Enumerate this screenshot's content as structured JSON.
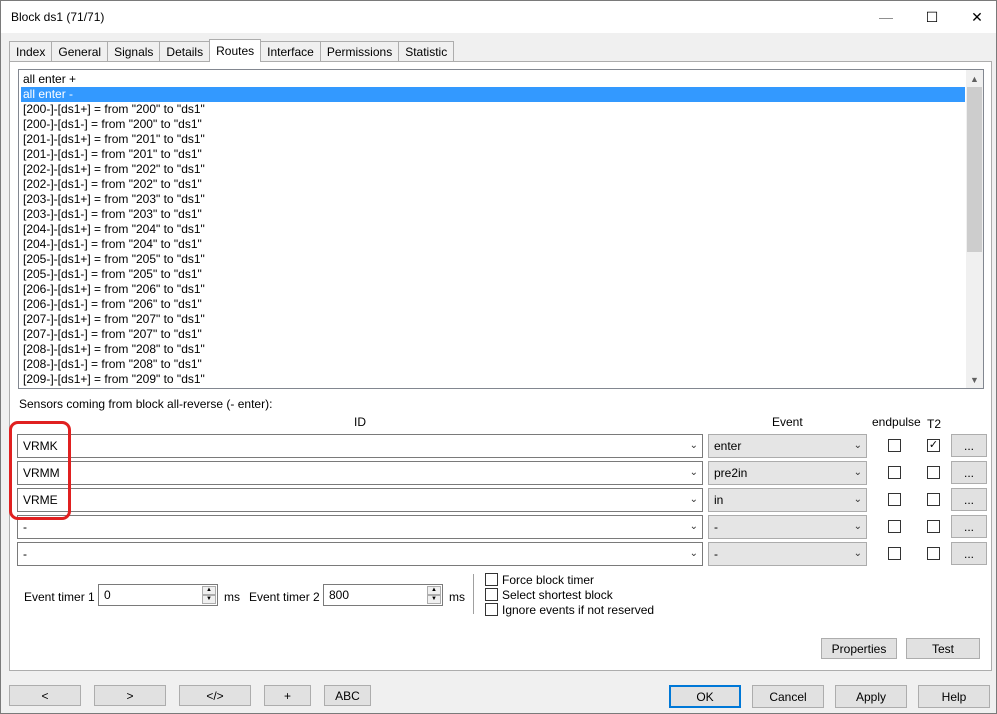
{
  "window": {
    "title": "Block ds1 (71/71)"
  },
  "icons": {
    "minimize": "minimize-icon",
    "maximize": "maximize-icon",
    "close": "close-icon",
    "dropdown": "chevron-down-icon",
    "check": "check-icon"
  },
  "tabs": [
    "Index",
    "General",
    "Signals",
    "Details",
    "Routes",
    "Interface",
    "Permissions",
    "Statistic"
  ],
  "active_tab": "Routes",
  "routes": [
    "all enter +",
    "all enter -",
    "[200-]-[ds1+] = from \"200\" to \"ds1\"",
    "[200-]-[ds1-] = from \"200\" to \"ds1\"",
    "[201-]-[ds1+] = from \"201\" to \"ds1\"",
    "[201-]-[ds1-] = from \"201\" to \"ds1\"",
    "[202-]-[ds1+] = from \"202\" to \"ds1\"",
    "[202-]-[ds1-] = from \"202\" to \"ds1\"",
    "[203-]-[ds1+] = from \"203\" to \"ds1\"",
    "[203-]-[ds1-] = from \"203\" to \"ds1\"",
    "[204-]-[ds1+] = from \"204\" to \"ds1\"",
    "[204-]-[ds1-] = from \"204\" to \"ds1\"",
    "[205-]-[ds1+] = from \"205\" to \"ds1\"",
    "[205-]-[ds1-] = from \"205\" to \"ds1\"",
    "[206-]-[ds1+] = from \"206\" to \"ds1\"",
    "[206-]-[ds1-] = from \"206\" to \"ds1\"",
    "[207-]-[ds1+] = from \"207\" to \"ds1\"",
    "[207-]-[ds1-] = from \"207\" to \"ds1\"",
    "[208-]-[ds1+] = from \"208\" to \"ds1\"",
    "[208-]-[ds1-] = from \"208\" to \"ds1\"",
    "[209-]-[ds1+] = from \"209\" to \"ds1\""
  ],
  "selected_route": "all enter -",
  "sensors": {
    "label": "Sensors coming from block all-reverse (- enter):",
    "headers": {
      "id": "ID",
      "event": "Event",
      "endpulse": "endpulse",
      "t2": "T2"
    },
    "rows": [
      {
        "id": "VRMK",
        "event": "enter",
        "endpulse": false,
        "t2": true,
        "more": "..."
      },
      {
        "id": "VRMM",
        "event": "pre2in",
        "endpulse": false,
        "t2": false,
        "more": "..."
      },
      {
        "id": "VRME",
        "event": "in",
        "endpulse": false,
        "t2": false,
        "more": "..."
      },
      {
        "id": "-",
        "event": "-",
        "endpulse": false,
        "t2": false,
        "more": "..."
      },
      {
        "id": "-",
        "event": "-",
        "endpulse": false,
        "t2": false,
        "more": "..."
      }
    ]
  },
  "timers": {
    "timer1_label": "Event timer 1",
    "timer1_value": "0",
    "timer1_unit": "ms",
    "timer2_label": "Event timer 2",
    "timer2_value": "800",
    "timer2_unit": "ms"
  },
  "options": [
    {
      "label": "Force block timer",
      "checked": false
    },
    {
      "label": "Select shortest block",
      "checked": false
    },
    {
      "label": "Ignore events if not reserved",
      "checked": false
    }
  ],
  "panel_buttons": {
    "properties": "Properties",
    "test": "Test"
  },
  "footer": {
    "prev": "<",
    "next": ">",
    "code": "</>",
    "add": "+",
    "abc": "ABC",
    "ok": "OK",
    "cancel": "Cancel",
    "apply": "Apply",
    "help": "Help"
  },
  "colors": {
    "selection": "#3399ff",
    "highlight": "#e02020",
    "default_button": "#0078d7"
  }
}
